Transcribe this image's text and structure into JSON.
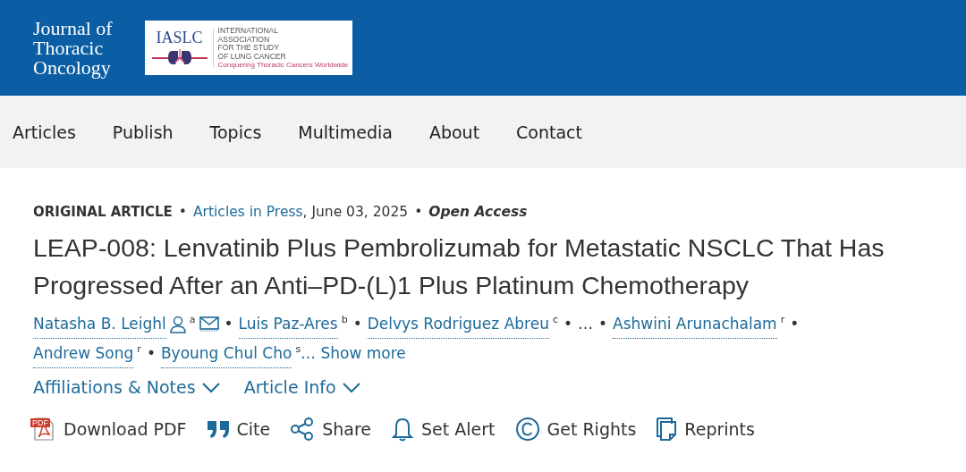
{
  "header": {
    "journal_lines": [
      "Journal of",
      "Thoracic",
      "Oncology"
    ],
    "partner": {
      "acronym": "IASLC",
      "name_lines": [
        "INTERNATIONAL",
        "ASSOCIATION",
        "FOR THE STUDY",
        "OF LUNG CANCER"
      ],
      "tagline": "Conquering Thoracic Cancers Worldwide"
    }
  },
  "nav": [
    {
      "label": "Articles"
    },
    {
      "label": "Publish"
    },
    {
      "label": "Topics"
    },
    {
      "label": "Multimedia"
    },
    {
      "label": "About"
    },
    {
      "label": "Contact"
    }
  ],
  "meta": {
    "type": "ORIGINAL ARTICLE",
    "section": "Articles in Press",
    "date": ", June 03, 2025",
    "access": "Open Access",
    "separator": "•"
  },
  "title": "LEAP-008: Lenvatinib Plus Pembrolizumab for Metastatic NSCLC That Has Progressed After an Anti–PD-(L)1 Plus Platinum Chemotherapy",
  "authors": [
    {
      "kind": "author",
      "name": "Natasha B. Leighl",
      "person_icon": true,
      "sup": "a",
      "mail_icon": true
    },
    {
      "kind": "author",
      "name": "Luis Paz-Ares",
      "sup": "b"
    },
    {
      "kind": "author",
      "name": "Delvys Rodriguez Abreu",
      "sup": "c"
    },
    {
      "kind": "ellipsis",
      "name": "…"
    },
    {
      "kind": "author",
      "name": "Ashwini Arunachalam",
      "sup": "r"
    },
    {
      "kind": "author",
      "name": "Andrew Song",
      "sup": "r"
    },
    {
      "kind": "author",
      "name": "Byoung Chul Cho",
      "sup": "s"
    }
  ],
  "show_more": "… Show more",
  "toggles": [
    {
      "label": "Affiliations & Notes",
      "expanded": false
    },
    {
      "label": "Article Info",
      "expanded": false
    }
  ],
  "actions": [
    {
      "kind": "pdf",
      "label": "Download PDF",
      "icon_text": "PDF"
    },
    {
      "kind": "cite",
      "label": "Cite"
    },
    {
      "kind": "share",
      "label": "Share"
    },
    {
      "kind": "alert",
      "label": "Set Alert"
    },
    {
      "kind": "rights",
      "label": "Get Rights"
    },
    {
      "kind": "reprints",
      "label": "Reprints"
    }
  ]
}
